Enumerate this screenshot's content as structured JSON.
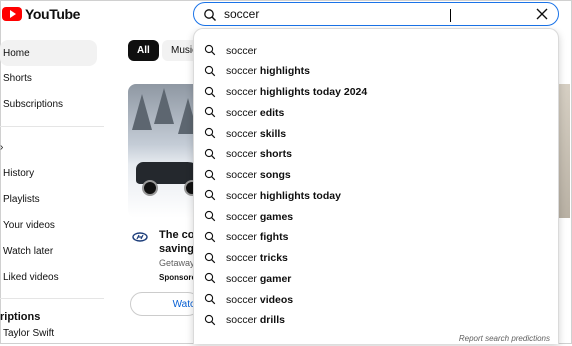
{
  "header": {
    "logo_text": "YouTube",
    "search": {
      "value": "soccer"
    }
  },
  "sidebar": {
    "items": [
      {
        "label": "Home"
      },
      {
        "label": "Shorts"
      },
      {
        "label": "Subscriptions"
      }
    ],
    "you_items": [
      {
        "label": "History"
      },
      {
        "label": "Playlists"
      },
      {
        "label": "Your videos"
      },
      {
        "label": "Watch later"
      },
      {
        "label": "Liked videos"
      }
    ],
    "subscriptions_title": "riptions",
    "subscriptions": [
      {
        "label": "Taylor Swift"
      }
    ]
  },
  "chips": [
    {
      "label": "All"
    },
    {
      "label": "Music"
    }
  ],
  "video_card": {
    "title_line1": "The co",
    "title_line2": "savings",
    "channel": "Getaway",
    "sponsored": "Sponsore",
    "watch_button": "Watc"
  },
  "suggestions": {
    "query": "soccer",
    "items": [
      {
        "prefix": "soccer",
        "suffix": ""
      },
      {
        "prefix": "soccer",
        "suffix": " highlights"
      },
      {
        "prefix": "soccer",
        "suffix": " highlights today 2024"
      },
      {
        "prefix": "soccer",
        "suffix": " edits"
      },
      {
        "prefix": "soccer",
        "suffix": " skills"
      },
      {
        "prefix": "soccer",
        "suffix": " shorts"
      },
      {
        "prefix": "soccer",
        "suffix": " songs"
      },
      {
        "prefix": "soccer",
        "suffix": " highlights today"
      },
      {
        "prefix": "soccer",
        "suffix": " games"
      },
      {
        "prefix": "soccer",
        "suffix": " fights"
      },
      {
        "prefix": "soccer",
        "suffix": " tricks"
      },
      {
        "prefix": "soccer",
        "suffix": " gamer"
      },
      {
        "prefix": "soccer",
        "suffix": " videos"
      },
      {
        "prefix": "soccer",
        "suffix": " drills"
      }
    ],
    "report_text": "Report search predictions"
  },
  "colors": {
    "brand": "#ff0000",
    "focus": "#1a73e8",
    "link": "#065fd4"
  }
}
